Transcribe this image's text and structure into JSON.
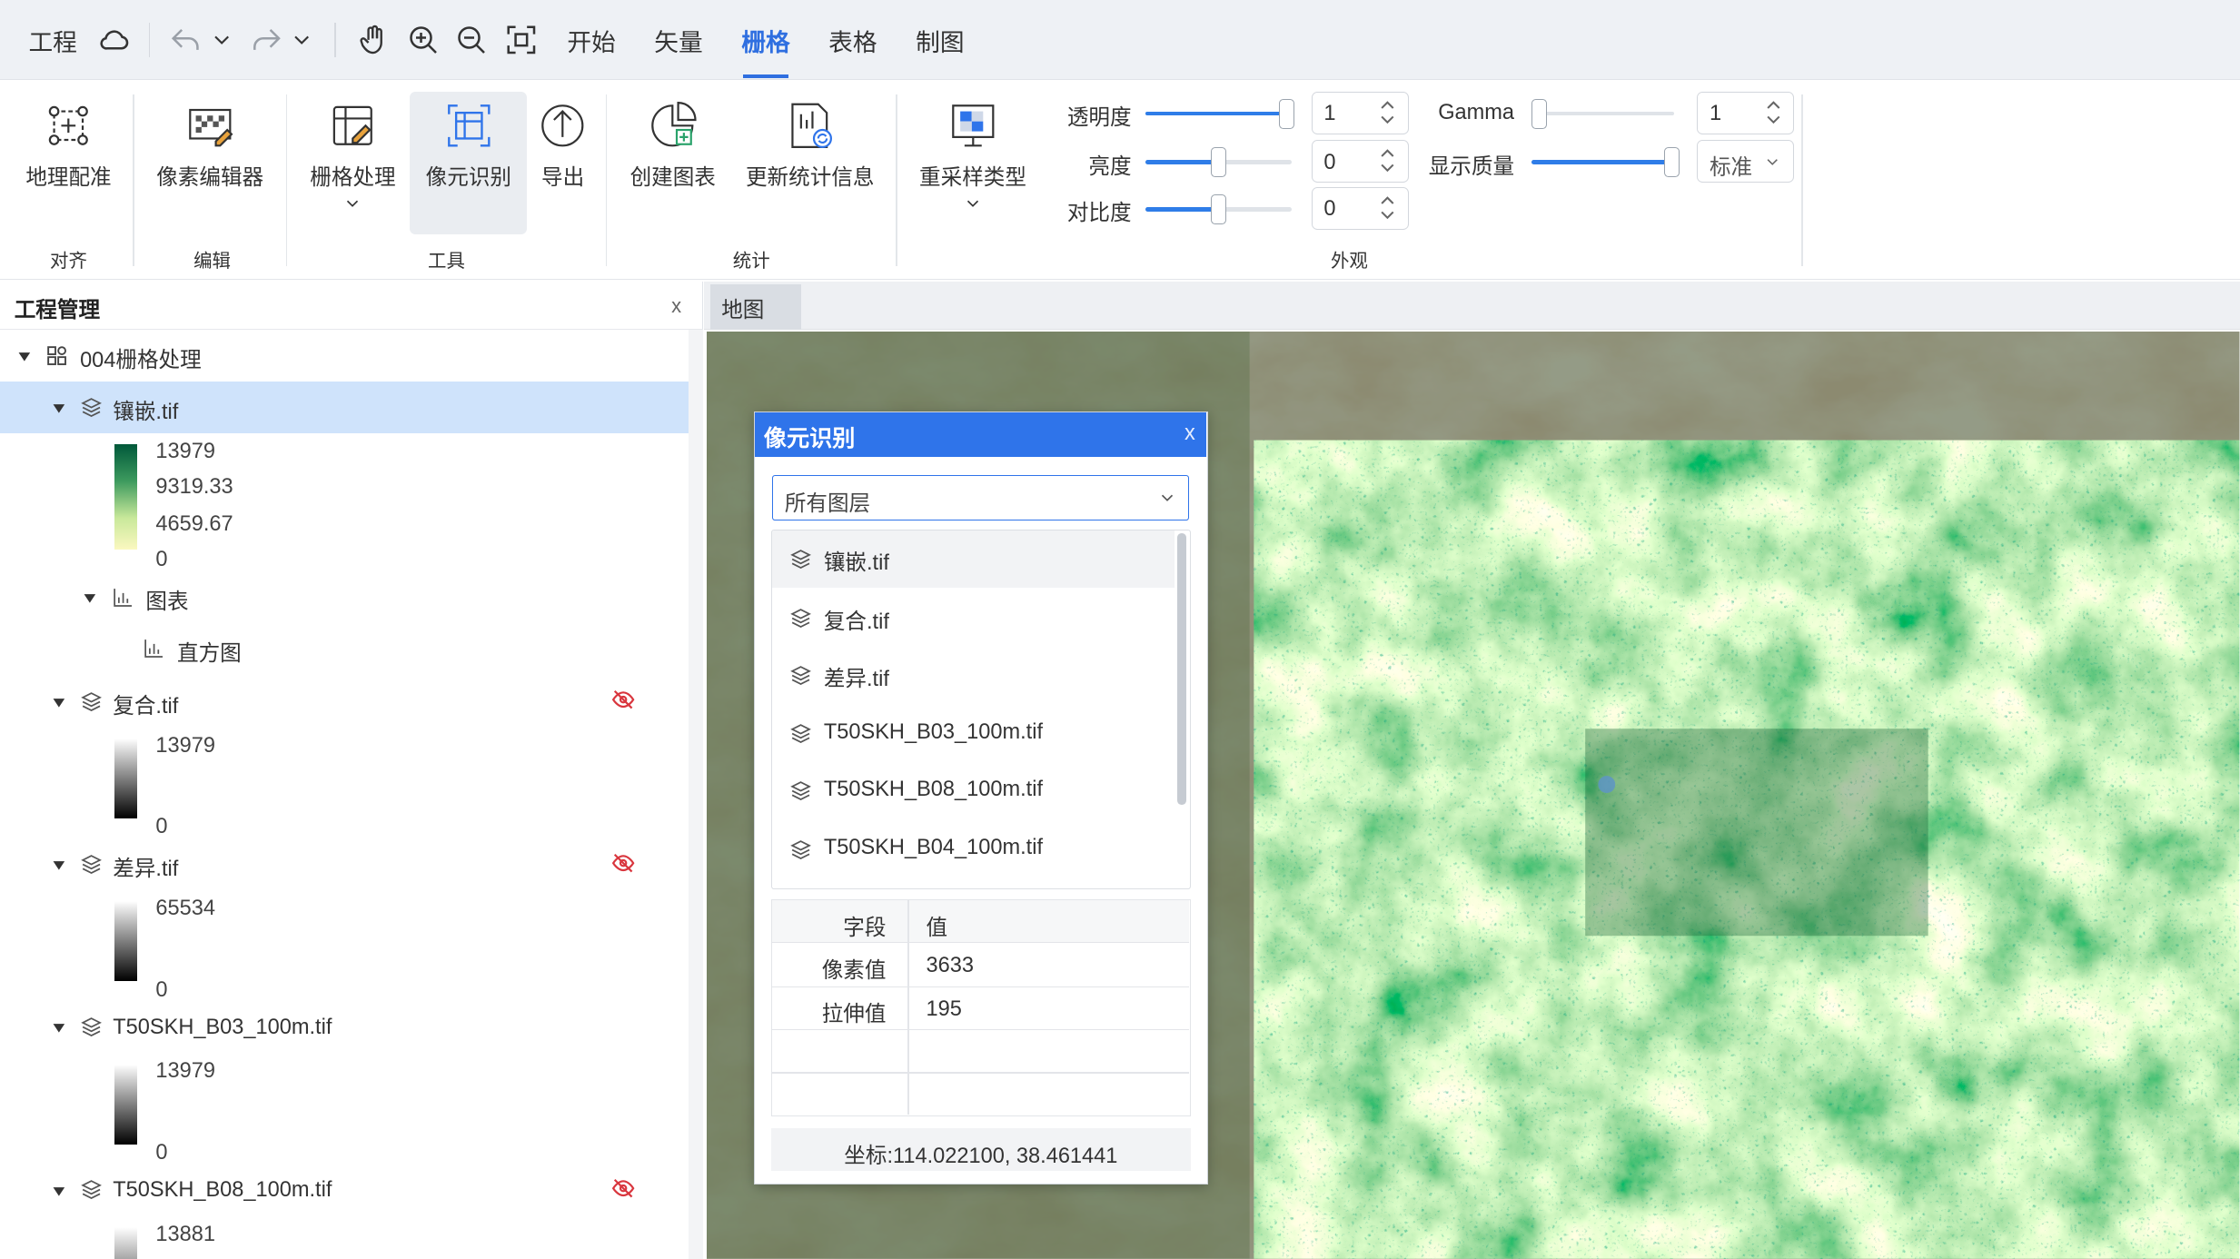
{
  "topbar": {
    "project": "工程",
    "menus": [
      "开始",
      "矢量",
      "栅格",
      "表格",
      "制图"
    ]
  },
  "ribbon": {
    "buttons": {
      "georef": "地理配准",
      "pixel_editor": "像素编辑器",
      "raster_process": "栅格处理",
      "pixel_identify": "像元识别",
      "export": "导出",
      "create_chart": "创建图表",
      "update_stats": "更新统计信息",
      "resample": "重采样类型"
    },
    "groups": {
      "align": "对齐",
      "edit": "编辑",
      "tools": "工具",
      "stats": "统计",
      "appearance": "外观"
    },
    "appearance": {
      "transparency_label": "透明度",
      "transparency_value": "1",
      "brightness_label": "亮度",
      "brightness_value": "0",
      "contrast_label": "对比度",
      "contrast_value": "0",
      "gamma_label": "Gamma",
      "gamma_value": "1",
      "quality_label": "显示质量",
      "quality_value": "标准",
      "transparency_level": 1.0,
      "brightness_level": 0.5,
      "contrast_level": 0.5,
      "gamma_level": 0.05,
      "quality_level": 1.0
    }
  },
  "left_panel": {
    "title": "工程管理",
    "close": "x",
    "project_name": "004栅格处理",
    "layers": [
      {
        "name": "镶嵌.tif",
        "legend": [
          "13979",
          "9319.33",
          "4659.67",
          "0"
        ]
      },
      {
        "name": "复合.tif",
        "legend": [
          "13979",
          "0"
        ]
      },
      {
        "name": "差异.tif",
        "legend": [
          "65534",
          "0"
        ]
      },
      {
        "name": "T50SKH_B03_100m.tif",
        "legend": [
          "13979",
          "0"
        ]
      },
      {
        "name": "T50SKH_B08_100m.tif",
        "legend": [
          "13881"
        ]
      }
    ],
    "chart_node": "图表",
    "histogram_node": "直方图"
  },
  "map": {
    "tab": "地图"
  },
  "popup": {
    "title": "像元识别",
    "close": "x",
    "layer_select": "所有图层",
    "layer_list": [
      "镶嵌.tif",
      "复合.tif",
      "差异.tif",
      "T50SKH_B03_100m.tif",
      "T50SKH_B08_100m.tif",
      "T50SKH_B04_100m.tif"
    ],
    "table": {
      "headers": [
        "字段",
        "值"
      ],
      "rows": [
        [
          "像素值",
          "3633"
        ],
        [
          "拉伸值",
          "195"
        ]
      ]
    },
    "coord_label": "坐标:",
    "coord_value": "114.022100, 38.461441"
  },
  "colors": {
    "accent": "#2f74ea",
    "legend_green_dark": "#00583a",
    "legend_green_light": "#fbf8c0"
  }
}
